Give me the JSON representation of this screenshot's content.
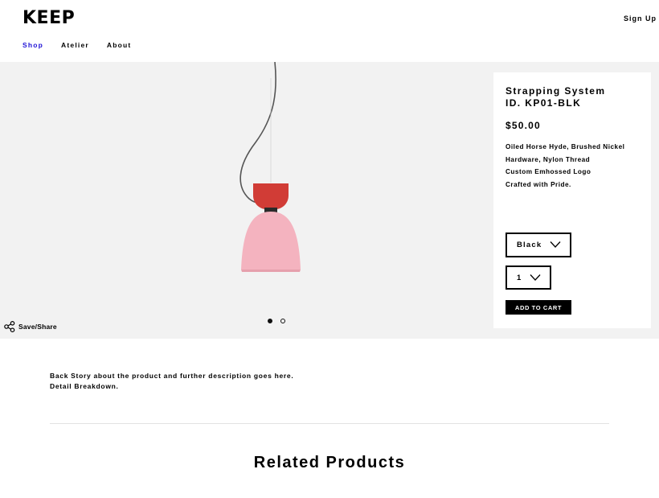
{
  "header": {
    "logo": "KEEP",
    "signup": "Sign Up",
    "nav": [
      {
        "label": "Shop",
        "active": true
      },
      {
        "label": "Atelier",
        "active": false
      },
      {
        "label": "About",
        "active": false
      }
    ],
    "accent_color": "#1f12d6"
  },
  "hero": {
    "background": "#f2f2f2",
    "carousel": {
      "total": 2,
      "current": 1
    },
    "share_label": "Save/Share"
  },
  "product": {
    "title_line1": "Strapping System",
    "title_line2": "ID. KP01-BLK",
    "price": "$50.00",
    "description": [
      "Oiled Horse Hyde, Brushed Nickel",
      "Hardware, Nylon Thread",
      "Custom Emhossed Logo",
      "Crafted with Pride."
    ],
    "color_select": "Black",
    "qty_select": "1",
    "add_to_cart": "ADD TO CART"
  },
  "story": {
    "line1": "Back Story about the product and further description goes here.",
    "line2": "Detail Breakdown."
  },
  "related": {
    "heading": "Related Products"
  }
}
